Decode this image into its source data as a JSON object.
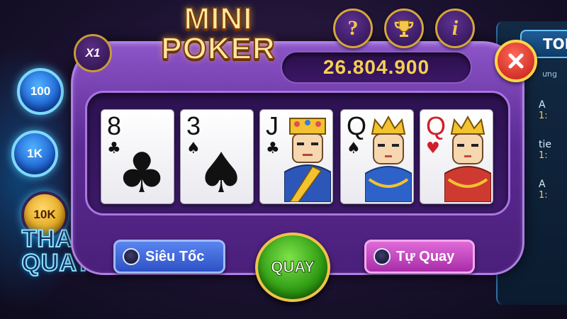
{
  "game": {
    "title_line1": "MINI",
    "title_line2": "POKER",
    "multiplier": "X1",
    "balance": "26.804.900"
  },
  "header_buttons": [
    {
      "name": "help",
      "glyph": "?"
    },
    {
      "name": "leaderboard",
      "glyph": "trophy-icon"
    },
    {
      "name": "info",
      "glyph": "i"
    }
  ],
  "bet_chips": [
    "100",
    "1K",
    "10K"
  ],
  "selected_bet": "10K",
  "promo_text": {
    "line1": "THAN",
    "line2": "QUAY"
  },
  "cards": [
    {
      "rank": "8",
      "suit": "♣",
      "color": "black",
      "face": false
    },
    {
      "rank": "3",
      "suit": "♠",
      "color": "black",
      "face": false
    },
    {
      "rank": "J",
      "suit": "♣",
      "color": "black",
      "face": true
    },
    {
      "rank": "Q",
      "suit": "♠",
      "color": "black",
      "face": true
    },
    {
      "rank": "Q",
      "suit": "♥",
      "color": "red",
      "face": true
    }
  ],
  "controls": {
    "fast_spin": "Siêu Tốc",
    "spin": "QUAY",
    "auto_spin": "Tự Quay"
  },
  "side_panel": {
    "title": "TOP",
    "subtitle": "ưng",
    "rows": [
      {
        "a": "A",
        "b": "1:"
      },
      {
        "a": "tie",
        "b": "1:"
      },
      {
        "a": "A",
        "b": "1:"
      }
    ]
  },
  "colors": {
    "machine": "#5b2a93",
    "balance_text": "#f5cf52",
    "spin_button": "#2e9a13",
    "close_button": "#c01a12"
  }
}
